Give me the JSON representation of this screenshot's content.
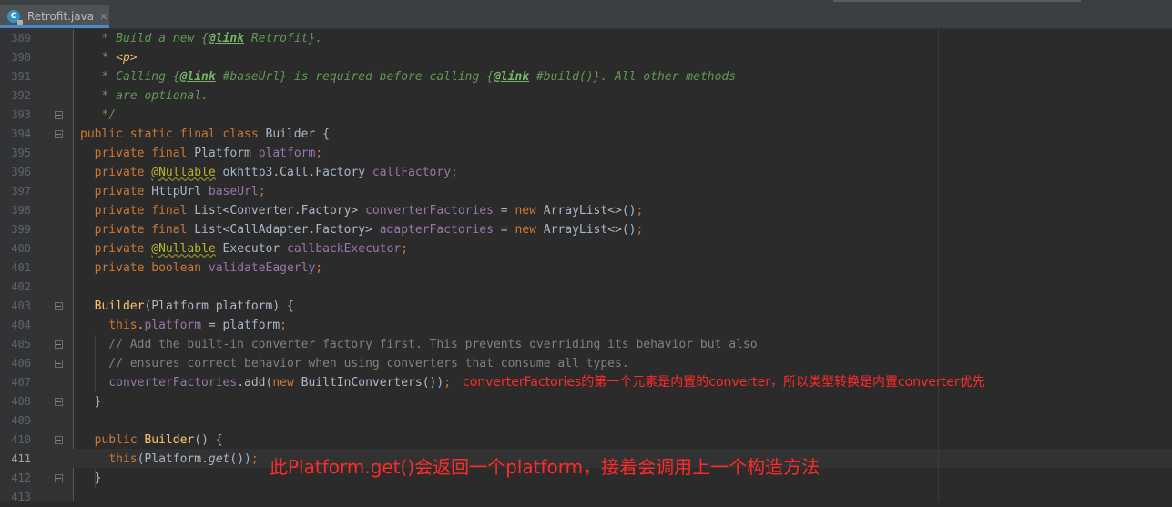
{
  "tab": {
    "filename": "Retrofit.java",
    "icon": "java-class-icon",
    "close_glyph": "✕"
  },
  "line_numbers": [
    "389",
    "390",
    "391",
    "392",
    "393",
    "394",
    "395",
    "396",
    "397",
    "398",
    "399",
    "400",
    "401",
    "402",
    "403",
    "404",
    "405",
    "406",
    "407",
    "408",
    "409",
    "410",
    "411",
    "412",
    "413"
  ],
  "current_line": "411",
  "code_lines": [
    [
      {
        "t": "   * Build a new {",
        "c": "cm"
      },
      {
        "t": "@link",
        "c": "tag"
      },
      {
        "t": " Retrofit}.",
        "c": "cm"
      }
    ],
    [
      {
        "t": "   * ",
        "c": "cm"
      },
      {
        "t": "<p>",
        "c": "htag"
      }
    ],
    [
      {
        "t": "   * Calling {",
        "c": "cm"
      },
      {
        "t": "@link",
        "c": "tag"
      },
      {
        "t": " #baseUrl} is required before calling {",
        "c": "cm"
      },
      {
        "t": "@link",
        "c": "tag"
      },
      {
        "t": " #build()}. All other methods",
        "c": "cm"
      }
    ],
    [
      {
        "t": "   * are optional.",
        "c": "cm"
      }
    ],
    [
      {
        "t": "   */",
        "c": "cm"
      }
    ],
    [
      {
        "t": "public static final class ",
        "c": "kw"
      },
      {
        "t": "Builder {",
        "c": ""
      }
    ],
    [
      {
        "t": "  ",
        "c": ""
      },
      {
        "t": "private final ",
        "c": "kw"
      },
      {
        "t": "Platform ",
        "c": ""
      },
      {
        "t": "platform",
        "c": "fld"
      },
      {
        "t": ";",
        "c": "kw"
      }
    ],
    [
      {
        "t": "  ",
        "c": ""
      },
      {
        "t": "private ",
        "c": "kw"
      },
      {
        "t": "@Nullable",
        "c": "an"
      },
      {
        "t": " okhttp3.Call.Factory ",
        "c": ""
      },
      {
        "t": "callFactory",
        "c": "fld"
      },
      {
        "t": ";",
        "c": "kw"
      }
    ],
    [
      {
        "t": "  ",
        "c": ""
      },
      {
        "t": "private ",
        "c": "kw"
      },
      {
        "t": "HttpUrl ",
        "c": ""
      },
      {
        "t": "baseUrl",
        "c": "fld"
      },
      {
        "t": ";",
        "c": "kw"
      }
    ],
    [
      {
        "t": "  ",
        "c": ""
      },
      {
        "t": "private final ",
        "c": "kw"
      },
      {
        "t": "List<Converter.Factory> ",
        "c": ""
      },
      {
        "t": "converterFactories",
        "c": "fld"
      },
      {
        "t": " = ",
        "c": ""
      },
      {
        "t": "new ",
        "c": "kw"
      },
      {
        "t": "ArrayList<>()",
        "c": ""
      },
      {
        "t": ";",
        "c": "kw"
      }
    ],
    [
      {
        "t": "  ",
        "c": ""
      },
      {
        "t": "private final ",
        "c": "kw"
      },
      {
        "t": "List<CallAdapter.Factory> ",
        "c": ""
      },
      {
        "t": "adapterFactories",
        "c": "fld"
      },
      {
        "t": " = ",
        "c": ""
      },
      {
        "t": "new ",
        "c": "kw"
      },
      {
        "t": "ArrayList<>()",
        "c": ""
      },
      {
        "t": ";",
        "c": "kw"
      }
    ],
    [
      {
        "t": "  ",
        "c": ""
      },
      {
        "t": "private ",
        "c": "kw"
      },
      {
        "t": "@Nullable",
        "c": "an"
      },
      {
        "t": " Executor ",
        "c": ""
      },
      {
        "t": "callbackExecutor",
        "c": "fld"
      },
      {
        "t": ";",
        "c": "kw"
      }
    ],
    [
      {
        "t": "  ",
        "c": ""
      },
      {
        "t": "private boolean ",
        "c": "kw"
      },
      {
        "t": "validateEagerly",
        "c": "fld"
      },
      {
        "t": ";",
        "c": "kw"
      }
    ],
    [],
    [
      {
        "t": "  ",
        "c": ""
      },
      {
        "t": "Builder",
        "c": "fn"
      },
      {
        "t": "(Platform platform) {",
        "c": ""
      }
    ],
    [
      {
        "t": "    ",
        "c": ""
      },
      {
        "t": "this",
        "c": "kw"
      },
      {
        "t": ".",
        "c": ""
      },
      {
        "t": "platform",
        "c": "fld"
      },
      {
        "t": " = platform",
        "c": ""
      },
      {
        "t": ";",
        "c": "kw"
      }
    ],
    [
      {
        "t": "    // Add the built-in converter factory first. This prevents overriding its behavior but also",
        "c": "lc"
      }
    ],
    [
      {
        "t": "    // ensures correct behavior when using converters that consume all types.",
        "c": "lc"
      }
    ],
    [
      {
        "t": "    ",
        "c": ""
      },
      {
        "t": "converterFactories",
        "c": "fld"
      },
      {
        "t": ".add(",
        "c": ""
      },
      {
        "t": "new ",
        "c": "kw"
      },
      {
        "t": "BuiltInConverters())",
        "c": ""
      },
      {
        "t": ";",
        "c": "kw"
      }
    ],
    [
      {
        "t": "  }",
        "c": ""
      }
    ],
    [],
    [
      {
        "t": "  ",
        "c": ""
      },
      {
        "t": "public ",
        "c": "kw"
      },
      {
        "t": "Builder",
        "c": "fn"
      },
      {
        "t": "() {",
        "c": ""
      }
    ],
    [
      {
        "t": "    ",
        "c": ""
      },
      {
        "t": "this",
        "c": "kw"
      },
      {
        "t": "(Platform.",
        "c": ""
      },
      {
        "t": "get",
        "c": "it"
      },
      {
        "t": "())",
        "c": ""
      },
      {
        "t": ";",
        "c": "kw"
      }
    ],
    [
      {
        "t": "  }",
        "c": ""
      }
    ],
    []
  ],
  "annotations": {
    "line407": "converterFactories的第一个元素是内置的converter，所以类型转换是内置converter优先",
    "line411": "此Platform.get()会返回一个platform，接着会调用上一个构造方法"
  },
  "colors": {
    "editor_background": "#2b2b2b",
    "keyword": "#cc7832",
    "field": "#9876aa",
    "doc_comment": "#629755",
    "line_comment": "#808080",
    "annotation_text": "#ff2a2a"
  }
}
